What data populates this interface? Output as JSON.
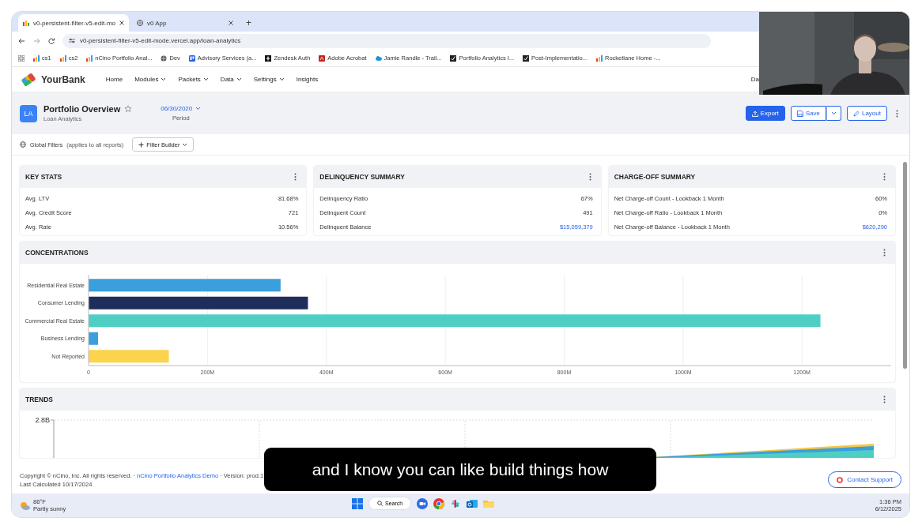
{
  "browser": {
    "tabs": [
      {
        "title": "v0-persistent-filter-v5-edit-mo",
        "selected": true
      },
      {
        "title": "v0 App",
        "selected": false
      }
    ],
    "new_tab": "+",
    "url": "v0-persistent-filter-v5-edit-mode.vercel.app/loan-analytics",
    "bookmarks": [
      {
        "label": "cs1",
        "kind": "chart"
      },
      {
        "label": "cs2",
        "kind": "chart"
      },
      {
        "label": "nCino Portfolio Anal...",
        "kind": "chart"
      },
      {
        "label": "Dev",
        "kind": "globe"
      },
      {
        "label": "Advisory Services (a...",
        "kind": "board"
      },
      {
        "label": "Zendesk Auth",
        "kind": "plus"
      },
      {
        "label": "Adobe Acrobat",
        "kind": "pdf"
      },
      {
        "label": "Jamie Randle - Trail...",
        "kind": "cloud"
      },
      {
        "label": "Portfolio Analytics I...",
        "kind": "check"
      },
      {
        "label": "Post-Implementatio...",
        "kind": "check"
      },
      {
        "label": "Rocketlane Home -...",
        "kind": "chart"
      }
    ]
  },
  "app": {
    "brand": "YourBank",
    "nav": [
      {
        "label": "Home",
        "dropdown": false
      },
      {
        "label": "Modules",
        "dropdown": true
      },
      {
        "label": "Packets",
        "dropdown": true
      },
      {
        "label": "Data",
        "dropdown": true
      },
      {
        "label": "Settings",
        "dropdown": true
      },
      {
        "label": "Insights",
        "dropdown": false
      }
    ],
    "user": "Da"
  },
  "header": {
    "badge": "LA",
    "title": "Portfolio Overview",
    "subtitle": "Loan Analytics",
    "favorite": false,
    "period": "06/30/2020",
    "period_label": "Period",
    "buttons": [
      {
        "label": "Export",
        "kind": "primary"
      },
      {
        "label": "Save",
        "kind": "split"
      },
      {
        "label": "Layout",
        "kind": "outline"
      }
    ]
  },
  "filters": {
    "label": "Global Filters",
    "note": "(applies to all reports)",
    "button": "Filter Builder"
  },
  "stat_cards": [
    {
      "title": "KEY STATS",
      "rows": [
        {
          "label": "Avg. LTV",
          "value": "81.68%",
          "link": false
        },
        {
          "label": "Avg. Credit Score",
          "value": "721",
          "link": false
        },
        {
          "label": "Avg. Rate",
          "value": "10.56%",
          "link": false
        }
      ]
    },
    {
      "title": "DELINQUENCY SUMMARY",
      "rows": [
        {
          "label": "Delinquency Ratio",
          "value": "67%",
          "link": false
        },
        {
          "label": "Delinquent Count",
          "value": "491",
          "link": false
        },
        {
          "label": "Delinquent Balance",
          "value": "$15,059,379",
          "link": true
        }
      ]
    },
    {
      "title": "CHARGE-OFF SUMMARY",
      "rows": [
        {
          "label": "Net Charge-off Count - Lookback 1 Month",
          "value": "60%",
          "link": false
        },
        {
          "label": "Net Charge-off Ratio - Lookback 1 Month",
          "value": "0%",
          "link": false
        },
        {
          "label": "Net Charge-off Balance - Lookback 1 Month",
          "value": "$620,290",
          "link": true
        }
      ]
    }
  ],
  "concentrations": {
    "title": "CONCENTRATIONS",
    "chart_data": {
      "type": "bar",
      "orientation": "horizontal",
      "categories": [
        "Residential Real Estate",
        "Consumer Lending",
        "Commercial Real Estate",
        "Business Lending",
        "Not Reported"
      ],
      "values": [
        323,
        369,
        1231,
        16,
        135
      ],
      "colors": [
        "#3b9fdb",
        "#1e2d5a",
        "#4fcfc4",
        "#3b9fdb",
        "#fcd34d"
      ],
      "xlim": [
        0,
        1350
      ],
      "grid": true,
      "xticks": [
        {
          "value": 0,
          "label": "0"
        },
        {
          "value": 200,
          "label": "200M"
        },
        {
          "value": 400,
          "label": "400M"
        },
        {
          "value": 600,
          "label": "600M"
        },
        {
          "value": 800,
          "label": "800M"
        },
        {
          "value": 1000,
          "label": "1000M"
        },
        {
          "value": 1200,
          "label": "1200M"
        }
      ]
    }
  },
  "trends": {
    "title": "TRENDS",
    "top_tick": "2.8B"
  },
  "footer": {
    "copyright": "Copyright © nCino, Inc. All rights reserved. · ",
    "link": "nCino Portfolio Analytics Demo",
    "version": " · Version: prod.1",
    "calculated": "Last Calculated 10/17/2024",
    "support": "Contact Support"
  },
  "caption": "and I know you can like build things how",
  "taskbar": {
    "temperature": "86°F",
    "weather": "Partly sunny",
    "search": "Search",
    "apps": [
      {
        "kind": "zoom"
      },
      {
        "kind": "chrome"
      },
      {
        "kind": "slack"
      },
      {
        "kind": "outlook"
      },
      {
        "kind": "folder"
      }
    ],
    "time": "1:36 PM",
    "date": "6/12/2025"
  }
}
